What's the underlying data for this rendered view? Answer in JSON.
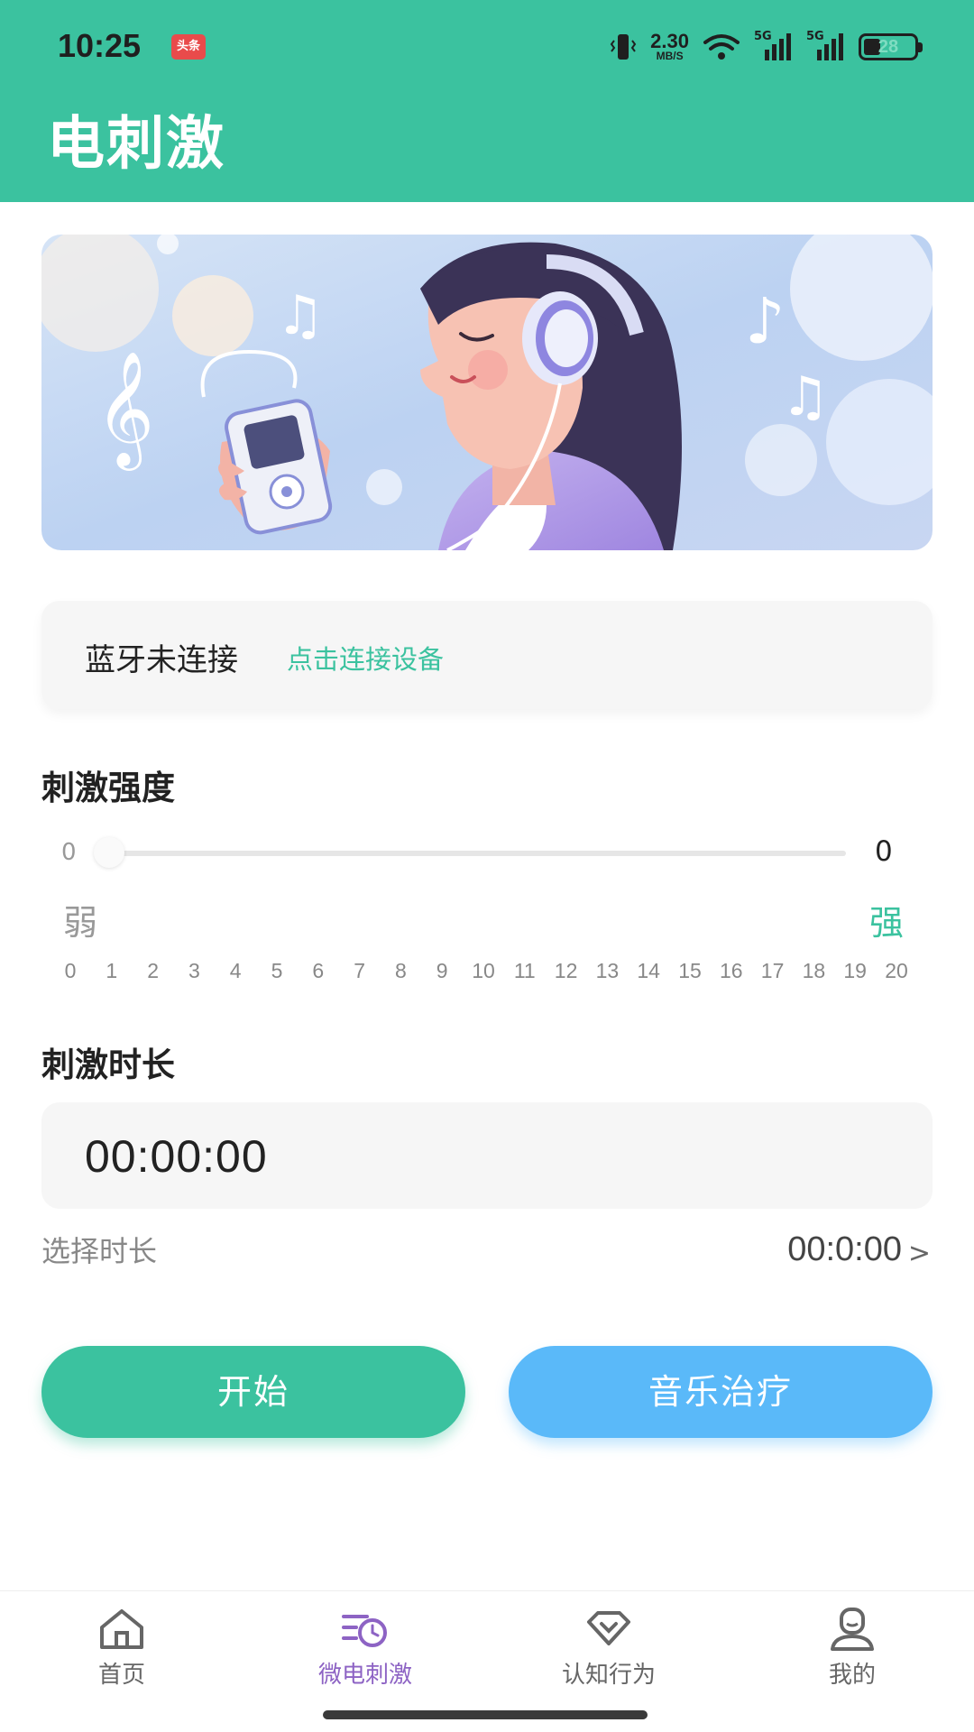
{
  "status_bar": {
    "time": "10:25",
    "notification_badge": "头条",
    "net_speed_value": "2.30",
    "net_speed_unit": "MB/S",
    "signal_1_label": "5G",
    "signal_2_label": "5G",
    "battery": "28"
  },
  "header": {
    "title": "电刺激"
  },
  "bluetooth": {
    "status": "蓝牙未连接",
    "connect_link": "点击连接设备"
  },
  "intensity": {
    "title": "刺激强度",
    "min_label": "0",
    "current_value": "0",
    "level_fraction": 0,
    "weak_label": "弱",
    "strong_label": "强",
    "ticks": [
      "0",
      "1",
      "2",
      "3",
      "4",
      "5",
      "6",
      "7",
      "8",
      "9",
      "10",
      "11",
      "12",
      "13",
      "14",
      "15",
      "16",
      "17",
      "18",
      "19",
      "20"
    ]
  },
  "duration": {
    "title": "刺激时长",
    "value": "00:00:00",
    "choose_label": "选择时长",
    "choose_value": "00:0:00",
    "chevron": ">"
  },
  "buttons": {
    "start": "开始",
    "music": "音乐治疗"
  },
  "bottom_nav": {
    "items": [
      {
        "label": "首页",
        "icon": "home-icon"
      },
      {
        "label": "微电刺激",
        "icon": "stimulation-timer-icon",
        "active": true
      },
      {
        "label": "认知行为",
        "icon": "diamond-heart-icon"
      },
      {
        "label": "我的",
        "icon": "profile-icon"
      }
    ]
  },
  "colors": {
    "primary": "#3bc29f",
    "secondary_button": "#5ab9f9",
    "nav_active": "#8d63c4",
    "nav_inactive": "#666666"
  }
}
